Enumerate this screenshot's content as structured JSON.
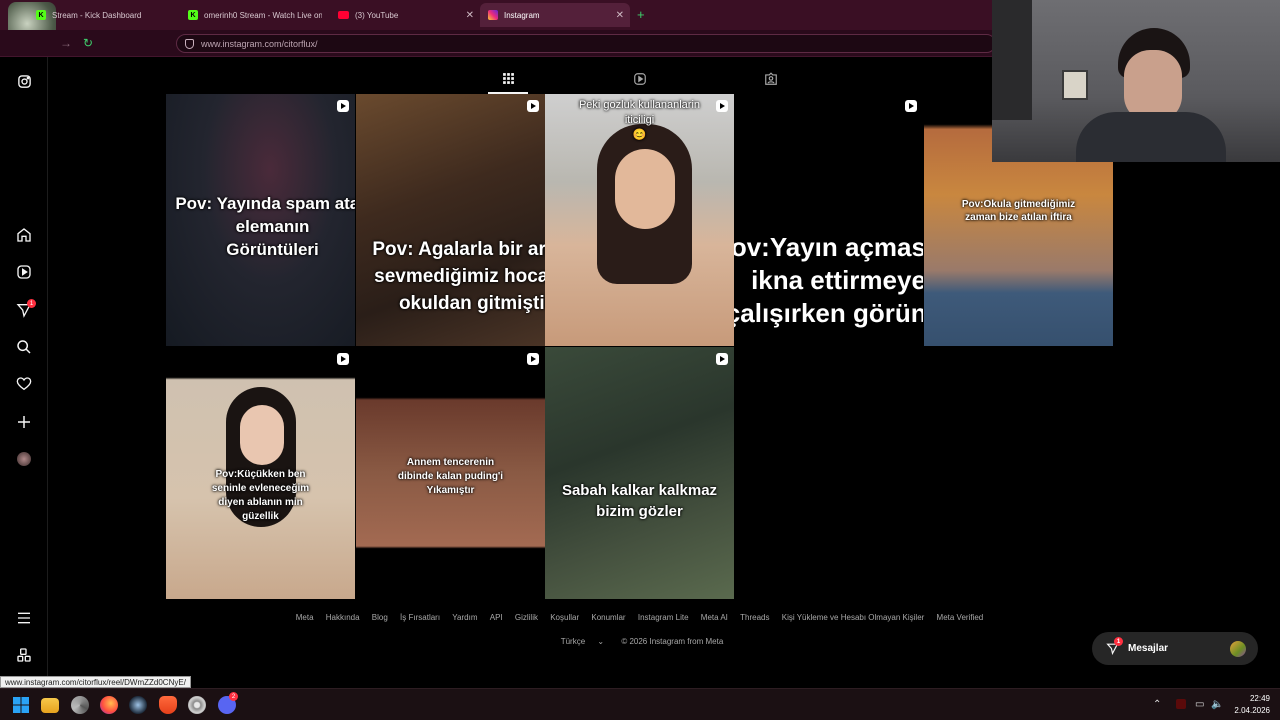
{
  "tabs": [
    {
      "label": "Stream - Kick Dashboard",
      "icon": "kick-icon",
      "active": false
    },
    {
      "label": "omerinh0 Stream - Watch Live on",
      "icon": "kick-icon",
      "active": false
    },
    {
      "label": "(3) YouTube",
      "icon": "youtube-icon",
      "active": false
    },
    {
      "label": "Instagram",
      "icon": "instagram-icon",
      "active": true
    }
  ],
  "address": {
    "url": "www.instagram.com/citorflux/"
  },
  "rail": {
    "notification_count": "1"
  },
  "posts": [
    {
      "caption": "Pov: Yayında spam atan\nelemanın\nGörüntüleri"
    },
    {
      "caption": "Pov: Agalarla bir arada\nsevmediğimiz hocanın\nokuldan gitmiştir"
    },
    {
      "caption": "Peki gozluk kullananlarin\niticiligi\n😊"
    },
    {
      "caption": "Pov:Yayın açmasına\nikna ettirmeye\nçalışırken görüntü"
    },
    {
      "caption": "Pov:Okula gitmediğimiz\nzaman bize atılan iftira"
    },
    {
      "caption": "Pov:Küçükken ben\nseninle evleneceğim\ndiyen ablanın min\ngüzellik"
    },
    {
      "caption": "Annem tencerenin\ndibinde kalan puding'i\nYıkamıştır"
    },
    {
      "caption": "Sabah kalkar kalkmaz\nbizim gözler"
    }
  ],
  "footer": {
    "links": [
      "Meta",
      "Hakkında",
      "Blog",
      "İş Fırsatları",
      "Yardım",
      "API",
      "Gizlilik",
      "Koşullar",
      "Konumlar",
      "Instagram Lite",
      "Meta AI",
      "Threads",
      "Kişi Yükleme ve Hesabı Olmayan Kişiler",
      "Meta Verified"
    ],
    "language": "Türkçe",
    "copyright": "© 2026 Instagram from Meta"
  },
  "messages": {
    "label": "Mesajlar",
    "count": "1"
  },
  "status_link": "www.instagram.com/citorflux/reel/DWmZZd0CNyE/",
  "taskbar": {
    "time": "22:49",
    "date": "2.04.2026",
    "discord_badge": "2"
  }
}
